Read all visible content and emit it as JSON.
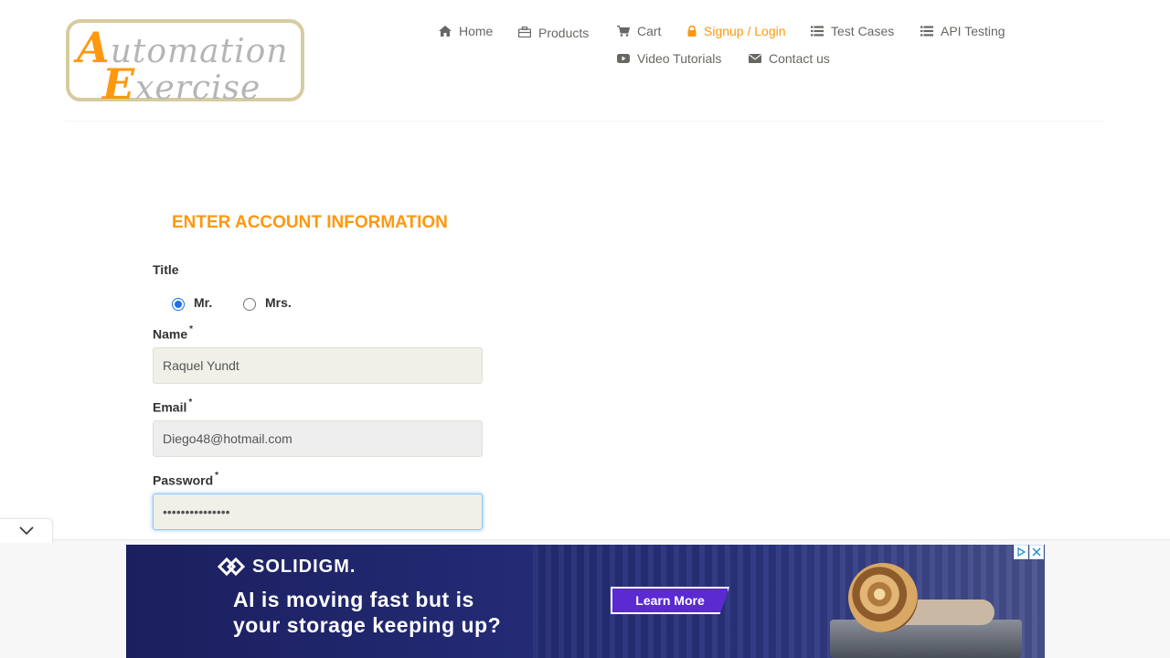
{
  "logo": {
    "line1_cap": "A",
    "line1_rest": "utomation",
    "line2_cap": "E",
    "line2_rest": "xercise"
  },
  "nav": {
    "items": [
      {
        "label": "Home",
        "icon": "home-icon"
      },
      {
        "label": "Products",
        "icon": "briefcase-icon"
      },
      {
        "label": "Cart",
        "icon": "cart-icon"
      },
      {
        "label": "Signup / Login",
        "icon": "lock-icon",
        "active": true
      },
      {
        "label": "Test Cases",
        "icon": "list-icon"
      },
      {
        "label": "API Testing",
        "icon": "list-icon"
      },
      {
        "label": "Video Tutorials",
        "icon": "youtube-icon"
      },
      {
        "label": "Contact us",
        "icon": "envelope-icon"
      }
    ]
  },
  "form": {
    "title": "ENTER ACCOUNT INFORMATION",
    "title_label": "Title",
    "title_options": [
      {
        "label": "Mr.",
        "checked": true
      },
      {
        "label": "Mrs.",
        "checked": false
      }
    ],
    "name_label": "Name",
    "name_value": "Raquel Yundt",
    "email_label": "Email",
    "email_value": "Diego48@hotmail.com",
    "password_label": "Password",
    "password_value": "•••••••••••••••",
    "required_mark": "*"
  },
  "ad": {
    "brand": "SOLIDIGM.",
    "headline": "AI is moving fast but is\nyour storage keeping up?",
    "cta": "Learn More"
  },
  "colors": {
    "accent": "#fe980f",
    "text": "#696763",
    "input_bg": "#f0f0e9",
    "ad_bg": "#1b1f5e"
  }
}
